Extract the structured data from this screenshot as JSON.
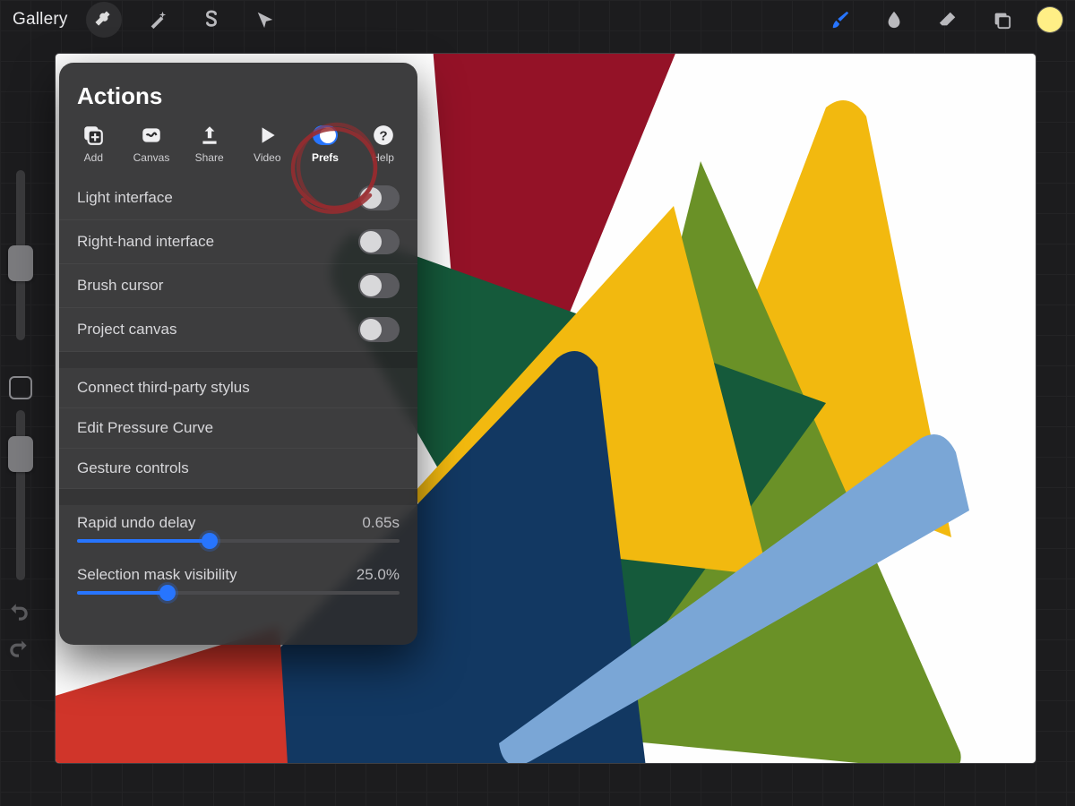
{
  "topbar": {
    "gallery_label": "Gallery"
  },
  "swatch_color": "#ffef86",
  "sidebar": {
    "size_thumb_pct": 44,
    "opacity_thumb_pct": 15
  },
  "actions_panel": {
    "title": "Actions",
    "tabs": [
      {
        "id": "add",
        "label": "Add"
      },
      {
        "id": "canvas",
        "label": "Canvas"
      },
      {
        "id": "share",
        "label": "Share"
      },
      {
        "id": "video",
        "label": "Video"
      },
      {
        "id": "prefs",
        "label": "Prefs",
        "selected": true
      },
      {
        "id": "help",
        "label": "Help"
      }
    ],
    "prefs": {
      "toggles": [
        {
          "label": "Light interface",
          "on": false
        },
        {
          "label": "Right-hand interface",
          "on": false
        },
        {
          "label": "Brush cursor",
          "on": false
        },
        {
          "label": "Project canvas",
          "on": false
        }
      ],
      "links": [
        {
          "label": "Connect third-party stylus"
        },
        {
          "label": "Edit Pressure Curve"
        },
        {
          "label": "Gesture controls"
        }
      ],
      "sliders": [
        {
          "label": "Rapid undo delay",
          "value_text": "0.65s",
          "fill_pct": 41
        },
        {
          "label": "Selection mask visibility",
          "value_text": "25.0%",
          "fill_pct": 28
        }
      ]
    }
  },
  "annotation": {
    "circled_tab": "prefs"
  }
}
